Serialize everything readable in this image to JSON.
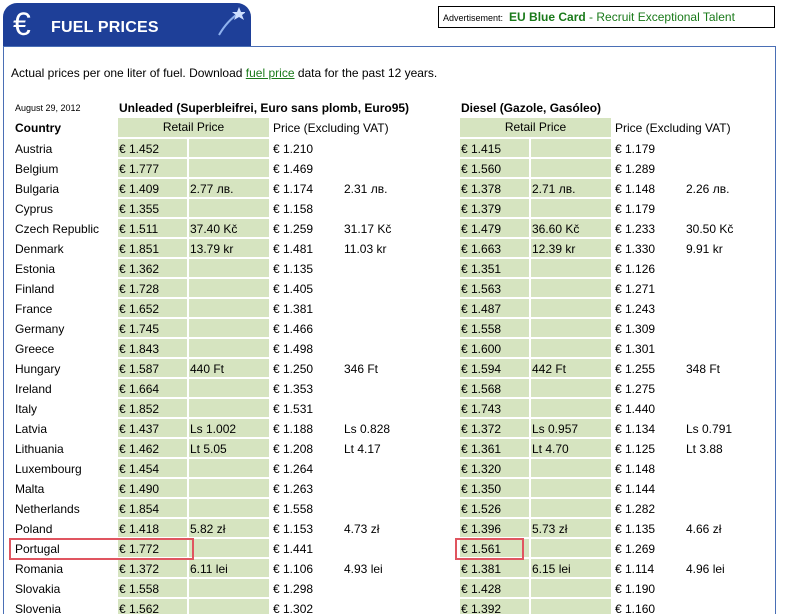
{
  "header": {
    "title": "FUEL PRICES",
    "euro_symbol": "€"
  },
  "ad": {
    "label": "Advertisement:",
    "brand": "EU Blue Card",
    "text": " - Recruit Exceptional Talent"
  },
  "intro": {
    "prefix": "Actual prices per one liter of fuel. Download ",
    "link": "fuel price",
    "suffix": " data for the past 12 years."
  },
  "date": "August 29, 2012",
  "unleaded": {
    "title": "Unleaded (Superbleifrei, Euro sans plomb, Euro95)",
    "retail_head": "Retail Price",
    "excl_head": "Price (Excluding VAT)"
  },
  "diesel": {
    "title": "Diesel (Gazole, Gasóleo)",
    "retail_head": "Retail Price",
    "excl_head": "Price (Excluding VAT)"
  },
  "country_head": "Country",
  "rows": [
    {
      "country": "Austria",
      "u_eur": "€ 1.452",
      "u_loc": "",
      "u_ex": "€ 1.210",
      "u_ex_loc": "",
      "d_eur": "€ 1.415",
      "d_loc": "",
      "d_ex": "€ 1.179",
      "d_ex_loc": ""
    },
    {
      "country": "Belgium",
      "u_eur": "€ 1.777",
      "u_loc": "",
      "u_ex": "€ 1.469",
      "u_ex_loc": "",
      "d_eur": "€ 1.560",
      "d_loc": "",
      "d_ex": "€ 1.289",
      "d_ex_loc": ""
    },
    {
      "country": "Bulgaria",
      "u_eur": "€ 1.409",
      "u_loc": "2.77 лв.",
      "u_ex": "€ 1.174",
      "u_ex_loc": "2.31 лв.",
      "d_eur": "€ 1.378",
      "d_loc": "2.71 лв.",
      "d_ex": "€ 1.148",
      "d_ex_loc": "2.26 лв."
    },
    {
      "country": "Cyprus",
      "u_eur": "€ 1.355",
      "u_loc": "",
      "u_ex": "€ 1.158",
      "u_ex_loc": "",
      "d_eur": "€ 1.379",
      "d_loc": "",
      "d_ex": "€ 1.179",
      "d_ex_loc": ""
    },
    {
      "country": "Czech Republic",
      "u_eur": "€ 1.511",
      "u_loc": "37.40 Kč",
      "u_ex": "€ 1.259",
      "u_ex_loc": "31.17 Kč",
      "d_eur": "€ 1.479",
      "d_loc": "36.60 Kč",
      "d_ex": "€ 1.233",
      "d_ex_loc": "30.50 Kč"
    },
    {
      "country": "Denmark",
      "u_eur": "€ 1.851",
      "u_loc": "13.79 kr",
      "u_ex": "€ 1.481",
      "u_ex_loc": "11.03 kr",
      "d_eur": "€ 1.663",
      "d_loc": "12.39 kr",
      "d_ex": "€ 1.330",
      "d_ex_loc": "9.91 kr"
    },
    {
      "country": "Estonia",
      "u_eur": "€ 1.362",
      "u_loc": "",
      "u_ex": "€ 1.135",
      "u_ex_loc": "",
      "d_eur": "€ 1.351",
      "d_loc": "",
      "d_ex": "€ 1.126",
      "d_ex_loc": ""
    },
    {
      "country": "Finland",
      "u_eur": "€ 1.728",
      "u_loc": "",
      "u_ex": "€ 1.405",
      "u_ex_loc": "",
      "d_eur": "€ 1.563",
      "d_loc": "",
      "d_ex": "€ 1.271",
      "d_ex_loc": ""
    },
    {
      "country": "France",
      "u_eur": "€ 1.652",
      "u_loc": "",
      "u_ex": "€ 1.381",
      "u_ex_loc": "",
      "d_eur": "€ 1.487",
      "d_loc": "",
      "d_ex": "€ 1.243",
      "d_ex_loc": ""
    },
    {
      "country": "Germany",
      "u_eur": "€ 1.745",
      "u_loc": "",
      "u_ex": "€ 1.466",
      "u_ex_loc": "",
      "d_eur": "€ 1.558",
      "d_loc": "",
      "d_ex": "€ 1.309",
      "d_ex_loc": ""
    },
    {
      "country": "Greece",
      "u_eur": "€ 1.843",
      "u_loc": "",
      "u_ex": "€ 1.498",
      "u_ex_loc": "",
      "d_eur": "€ 1.600",
      "d_loc": "",
      "d_ex": "€ 1.301",
      "d_ex_loc": ""
    },
    {
      "country": "Hungary",
      "u_eur": "€ 1.587",
      "u_loc": "440 Ft",
      "u_ex": "€ 1.250",
      "u_ex_loc": "346 Ft",
      "d_eur": "€ 1.594",
      "d_loc": "442 Ft",
      "d_ex": "€ 1.255",
      "d_ex_loc": "348 Ft"
    },
    {
      "country": "Ireland",
      "u_eur": "€ 1.664",
      "u_loc": "",
      "u_ex": "€ 1.353",
      "u_ex_loc": "",
      "d_eur": "€ 1.568",
      "d_loc": "",
      "d_ex": "€ 1.275",
      "d_ex_loc": ""
    },
    {
      "country": "Italy",
      "u_eur": "€ 1.852",
      "u_loc": "",
      "u_ex": "€ 1.531",
      "u_ex_loc": "",
      "d_eur": "€ 1.743",
      "d_loc": "",
      "d_ex": "€ 1.440",
      "d_ex_loc": ""
    },
    {
      "country": "Latvia",
      "u_eur": "€ 1.437",
      "u_loc": "Ls 1.002",
      "u_ex": "€ 1.188",
      "u_ex_loc": "Ls 0.828",
      "d_eur": "€ 1.372",
      "d_loc": "Ls 0.957",
      "d_ex": "€ 1.134",
      "d_ex_loc": "Ls 0.791"
    },
    {
      "country": "Lithuania",
      "u_eur": "€ 1.462",
      "u_loc": "Lt 5.05",
      "u_ex": "€ 1.208",
      "u_ex_loc": "Lt 4.17",
      "d_eur": "€ 1.361",
      "d_loc": "Lt 4.70",
      "d_ex": "€ 1.125",
      "d_ex_loc": "Lt 3.88"
    },
    {
      "country": "Luxembourg",
      "u_eur": "€ 1.454",
      "u_loc": "",
      "u_ex": "€ 1.264",
      "u_ex_loc": "",
      "d_eur": "€ 1.320",
      "d_loc": "",
      "d_ex": "€ 1.148",
      "d_ex_loc": ""
    },
    {
      "country": "Malta",
      "u_eur": "€ 1.490",
      "u_loc": "",
      "u_ex": "€ 1.263",
      "u_ex_loc": "",
      "d_eur": "€ 1.350",
      "d_loc": "",
      "d_ex": "€ 1.144",
      "d_ex_loc": ""
    },
    {
      "country": "Netherlands",
      "u_eur": "€ 1.854",
      "u_loc": "",
      "u_ex": "€ 1.558",
      "u_ex_loc": "",
      "d_eur": "€ 1.526",
      "d_loc": "",
      "d_ex": "€ 1.282",
      "d_ex_loc": ""
    },
    {
      "country": "Poland",
      "u_eur": "€ 1.418",
      "u_loc": "5.82 zł",
      "u_ex": "€ 1.153",
      "u_ex_loc": "4.73 zł",
      "d_eur": "€ 1.396",
      "d_loc": "5.73 zł",
      "d_ex": "€ 1.135",
      "d_ex_loc": "4.66 zł"
    },
    {
      "country": "Portugal",
      "u_eur": "€ 1.772",
      "u_loc": "",
      "u_ex": "€ 1.441",
      "u_ex_loc": "",
      "d_eur": "€ 1.561",
      "d_loc": "",
      "d_ex": "€ 1.269",
      "d_ex_loc": ""
    },
    {
      "country": "Romania",
      "u_eur": "€ 1.372",
      "u_loc": "6.11 lei",
      "u_ex": "€ 1.106",
      "u_ex_loc": "4.93 lei",
      "d_eur": "€ 1.381",
      "d_loc": "6.15 lei",
      "d_ex": "€ 1.114",
      "d_ex_loc": "4.96 lei"
    },
    {
      "country": "Slovakia",
      "u_eur": "€ 1.558",
      "u_loc": "",
      "u_ex": "€ 1.298",
      "u_ex_loc": "",
      "d_eur": "€ 1.428",
      "d_loc": "",
      "d_ex": "€ 1.190",
      "d_ex_loc": ""
    },
    {
      "country": "Slovenia",
      "u_eur": "€ 1.562",
      "u_loc": "",
      "u_ex": "€ 1.302",
      "u_ex_loc": "",
      "d_eur": "€ 1.392",
      "d_loc": "",
      "d_ex": "€ 1.160",
      "d_ex_loc": ""
    }
  ],
  "colors": {
    "header_blue": "#1e3f98",
    "retail_green": "#d6e4c0",
    "link_green": "#1a7a1a",
    "highlight_red": "#e05560"
  }
}
